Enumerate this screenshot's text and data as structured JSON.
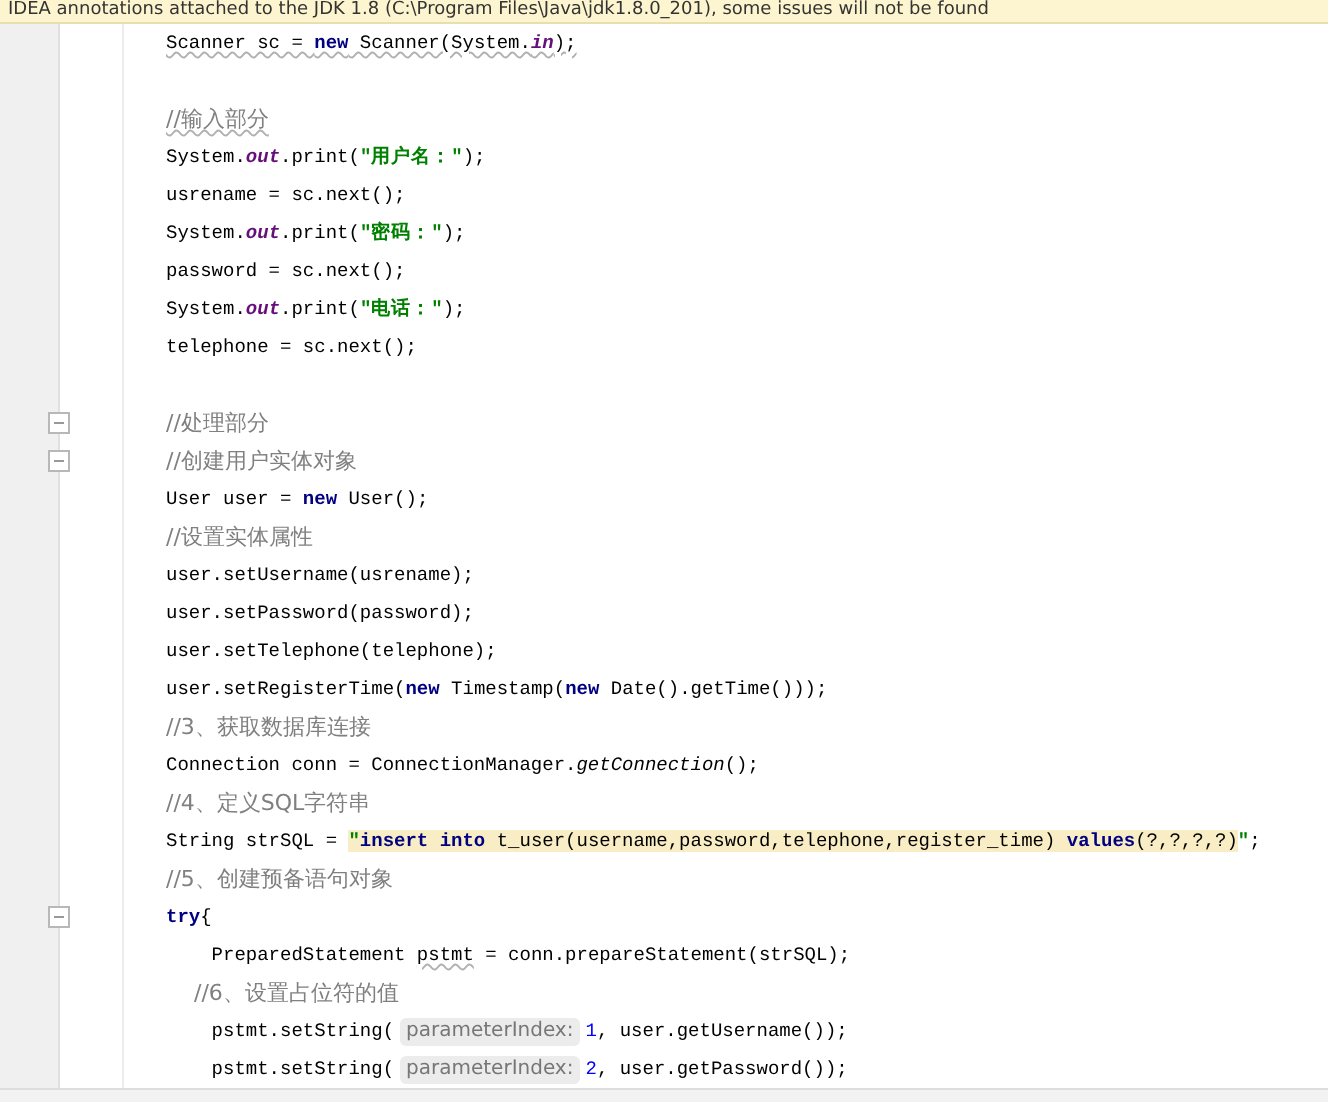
{
  "banner": {
    "text": "IDEA annotations attached to the JDK 1.8 (C:\\Program Files\\Java\\jdk1.8.0_201), some issues will not be found"
  },
  "lines": [
    {
      "tokens": [
        {
          "kind": "plain",
          "text": "Scanner sc = ",
          "squiggle": true
        },
        {
          "kind": "keyword",
          "text": "new",
          "squiggle": true
        },
        {
          "kind": "plain",
          "text": " Scanner(System.",
          "squiggle": true
        },
        {
          "kind": "static",
          "text": "in",
          "squiggle": true
        },
        {
          "kind": "plain",
          "text": ");",
          "squiggle": true
        }
      ]
    },
    {
      "blank_line_before": true,
      "tokens": [
        {
          "kind": "comment",
          "text": "//输入部分",
          "squiggle": true
        }
      ]
    },
    {
      "tokens": [
        {
          "kind": "plain",
          "text": "System."
        },
        {
          "kind": "static",
          "text": "out"
        },
        {
          "kind": "plain",
          "text": ".print("
        },
        {
          "kind": "string",
          "text": "\"用户名：\""
        },
        {
          "kind": "plain",
          "text": ");"
        }
      ]
    },
    {
      "tokens": [
        {
          "kind": "plain",
          "text": "usrename = sc.next();"
        }
      ]
    },
    {
      "tokens": [
        {
          "kind": "plain",
          "text": "System."
        },
        {
          "kind": "static",
          "text": "out"
        },
        {
          "kind": "plain",
          "text": ".print("
        },
        {
          "kind": "string",
          "text": "\"密码：\""
        },
        {
          "kind": "plain",
          "text": ");"
        }
      ]
    },
    {
      "tokens": [
        {
          "kind": "plain",
          "text": "password = sc.next();"
        }
      ]
    },
    {
      "tokens": [
        {
          "kind": "plain",
          "text": "System."
        },
        {
          "kind": "static",
          "text": "out"
        },
        {
          "kind": "plain",
          "text": ".print("
        },
        {
          "kind": "string",
          "text": "\"电话：\""
        },
        {
          "kind": "plain",
          "text": ");"
        }
      ]
    },
    {
      "tokens": [
        {
          "kind": "plain",
          "text": "telephone = sc.next();"
        }
      ]
    },
    {
      "blank_line_before": true,
      "fold": true,
      "tokens": [
        {
          "kind": "comment",
          "text": "//处理部分"
        }
      ]
    },
    {
      "fold": true,
      "tokens": [
        {
          "kind": "comment",
          "text": "//创建用户实体对象"
        }
      ]
    },
    {
      "tokens": [
        {
          "kind": "plain",
          "text": "User user = "
        },
        {
          "kind": "keyword",
          "text": "new"
        },
        {
          "kind": "plain",
          "text": " User();"
        }
      ]
    },
    {
      "tokens": [
        {
          "kind": "comment",
          "text": "//设置实体属性"
        }
      ]
    },
    {
      "tokens": [
        {
          "kind": "plain",
          "text": "user.setUsername(usrename);"
        }
      ]
    },
    {
      "tokens": [
        {
          "kind": "plain",
          "text": "user.setPassword(password);"
        }
      ]
    },
    {
      "tokens": [
        {
          "kind": "plain",
          "text": "user.setTelephone(telephone);"
        }
      ]
    },
    {
      "tokens": [
        {
          "kind": "plain",
          "text": "user.setRegisterTime("
        },
        {
          "kind": "keyword",
          "text": "new"
        },
        {
          "kind": "plain",
          "text": " Timestamp("
        },
        {
          "kind": "keyword",
          "text": "new"
        },
        {
          "kind": "plain",
          "text": " Date().getTime()));"
        }
      ]
    },
    {
      "tokens": [
        {
          "kind": "comment",
          "text": "//3、获取数据库连接"
        }
      ]
    },
    {
      "tokens": [
        {
          "kind": "plain",
          "text": "Connection conn = ConnectionManager."
        },
        {
          "kind": "method",
          "text": "getConnection"
        },
        {
          "kind": "plain",
          "text": "();"
        }
      ]
    },
    {
      "tokens": [
        {
          "kind": "comment",
          "text": "//4、定义SQL字符串"
        }
      ]
    },
    {
      "tokens": [
        {
          "kind": "plain",
          "text": "String strSQL = "
        },
        {
          "kind": "string",
          "text": "\"",
          "highlighted": true
        },
        {
          "kind": "keyword",
          "text": "insert into",
          "highlighted": true
        },
        {
          "kind": "plain",
          "text": " t_user(username,password,telephone,register_time) ",
          "highlighted": true
        },
        {
          "kind": "keyword",
          "text": "values",
          "highlighted": true
        },
        {
          "kind": "plain",
          "text": "(?,?,?,?)",
          "highlighted": true
        },
        {
          "kind": "string",
          "text": "\""
        },
        {
          "kind": "plain",
          "text": ";"
        }
      ]
    },
    {
      "tokens": [
        {
          "kind": "comment",
          "text": "//5、创建预备语句对象"
        }
      ]
    },
    {
      "fold": true,
      "tokens": [
        {
          "kind": "keyword",
          "text": "try"
        },
        {
          "kind": "plain",
          "text": "{"
        }
      ]
    },
    {
      "tokens": [
        {
          "kind": "plain",
          "text": "    PreparedStatement "
        },
        {
          "kind": "plain",
          "text": "pstmt",
          "squiggle": true
        },
        {
          "kind": "plain",
          "text": " = conn.prepareStatement(strSQL);"
        }
      ]
    },
    {
      "tokens": [
        {
          "kind": "comment",
          "text": "    //6、设置占位符的值"
        }
      ]
    },
    {
      "tokens": [
        {
          "kind": "plain",
          "text": "    pstmt.setString("
        },
        {
          "kind": "hint",
          "text": "parameterIndex:"
        },
        {
          "kind": "number",
          "text": "1"
        },
        {
          "kind": "plain",
          "text": ", user.getUsername());"
        }
      ]
    },
    {
      "tokens": [
        {
          "kind": "plain",
          "text": "    pstmt.setString("
        },
        {
          "kind": "hint",
          "text": "parameterIndex:"
        },
        {
          "kind": "number",
          "text": "2"
        },
        {
          "kind": "plain",
          "text": ", user.getPassword());"
        }
      ]
    }
  ]
}
